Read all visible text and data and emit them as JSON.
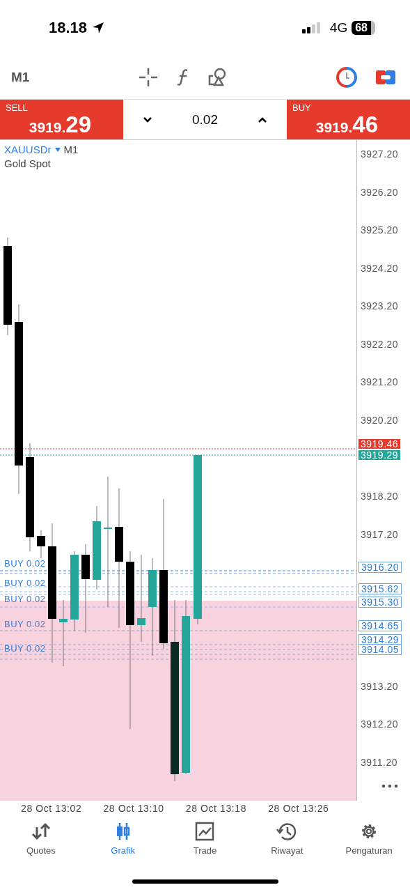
{
  "status_bar": {
    "time": "18.18",
    "network": "4G",
    "battery": "68"
  },
  "toolbar": {
    "timeframe": "M1"
  },
  "trade_bar": {
    "sell": {
      "label": "SELL",
      "price_small": "3919.",
      "price_big": "29"
    },
    "volume": "0.02",
    "buy": {
      "label": "BUY",
      "price_small": "3919.",
      "price_big": "46"
    }
  },
  "chart": {
    "symbol": "XAUUSDr",
    "timeframe": "M1",
    "description": "Gold Spot",
    "y_axis": [
      "3927.20",
      "3926.20",
      "3925.20",
      "3924.20",
      "3923.20",
      "3922.20",
      "3921.20",
      "3920.20",
      "3918.20",
      "3917.20",
      "3913.20",
      "3912.20",
      "3911.20"
    ],
    "price_tags": [
      {
        "text": "3919.46",
        "kind": "ask"
      },
      {
        "text": "3919.29",
        "kind": "bid"
      },
      {
        "text": "3916.20",
        "kind": "order"
      },
      {
        "text": "3915.62",
        "kind": "order"
      },
      {
        "text": "3915.30",
        "kind": "order"
      },
      {
        "text": "3914.65",
        "kind": "order"
      },
      {
        "text": "3914.29",
        "kind": "order"
      },
      {
        "text": "3914.05",
        "kind": "order"
      }
    ],
    "order_labels": [
      "BUY 0.02",
      "BUY 0.02",
      "BUY 0.02",
      "BUY 0.02",
      "BUY 0.02"
    ],
    "x_axis": [
      "28 Oct 13:02",
      "28 Oct 13:10",
      "28 Oct 13:18",
      "28 Oct 13:26"
    ]
  },
  "tabs": [
    {
      "label": "Quotes",
      "selected": false
    },
    {
      "label": "Grafik",
      "selected": true
    },
    {
      "label": "Trade",
      "selected": false
    },
    {
      "label": "Riwayat",
      "selected": false
    },
    {
      "label": "Pengaturan",
      "selected": false
    }
  ]
}
